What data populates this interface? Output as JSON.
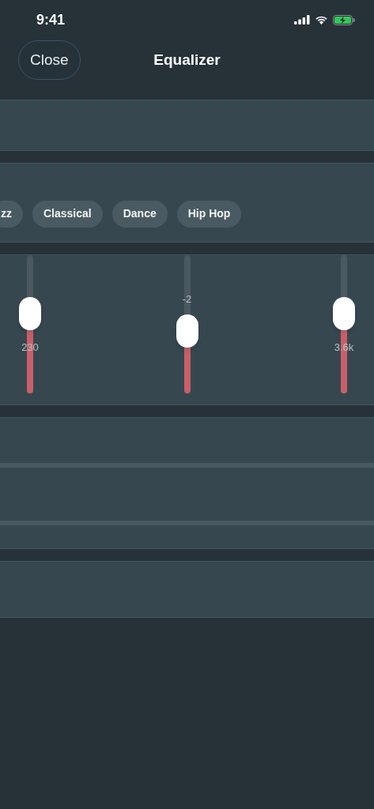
{
  "status_bar": {
    "time": "9:41"
  },
  "nav": {
    "close_button": "Close",
    "title": "Equalizer"
  },
  "presets": [
    {
      "label": "zz"
    },
    {
      "label": "Classical"
    },
    {
      "label": "Dance"
    },
    {
      "label": "Hip Hop"
    }
  ],
  "bands": [
    {
      "frequency": "230",
      "level": 0.58
    },
    {
      "value": "-2",
      "level": 0.45
    },
    {
      "frequency": "3.6k",
      "level": 0.58
    }
  ]
}
